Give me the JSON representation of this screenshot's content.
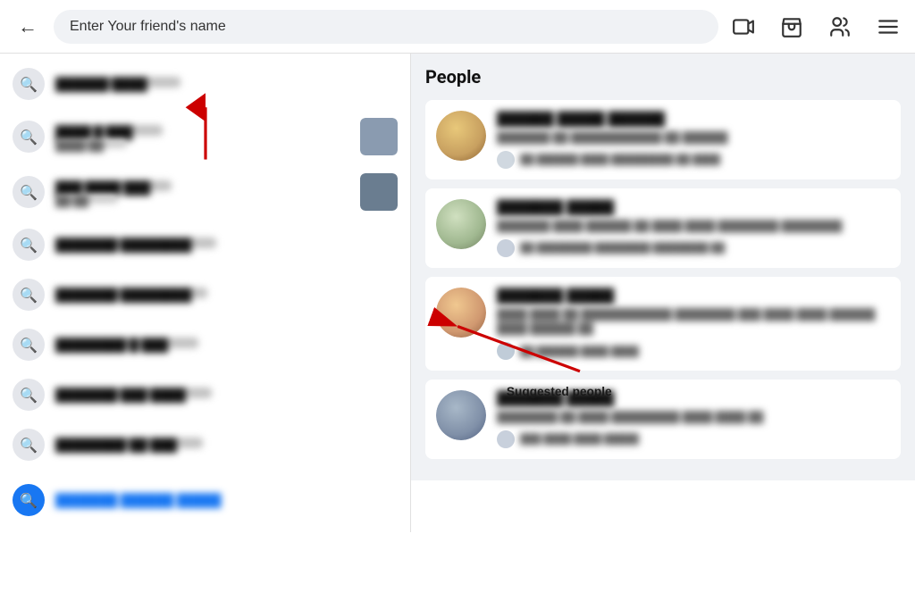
{
  "header": {
    "back_label": "←",
    "search_placeholder": "Enter Your friend's name",
    "nav_icons": [
      "video-icon",
      "shop-icon",
      "people-icon",
      "menu-icon"
    ]
  },
  "left_panel": {
    "results": [
      {
        "id": 1,
        "main": "██████ ████",
        "sub": "",
        "has_avatar": false,
        "avatar_color": ""
      },
      {
        "id": 2,
        "main": "████ █ ███",
        "sub": "████ ██",
        "has_avatar": true,
        "avatar_color": "#8a9bb0"
      },
      {
        "id": 3,
        "main": "███ ████ ███",
        "sub": "██ ██",
        "has_avatar": true,
        "avatar_color": "#6a7d90"
      },
      {
        "id": 4,
        "main": "███████ ████████",
        "sub": "",
        "has_avatar": false,
        "avatar_color": ""
      },
      {
        "id": 5,
        "main": "███████ ████████",
        "sub": "",
        "has_avatar": false,
        "avatar_color": ""
      },
      {
        "id": 6,
        "main": "████████ █ ███",
        "sub": "",
        "has_avatar": false,
        "avatar_color": ""
      },
      {
        "id": 7,
        "main": "███████ ███ ████",
        "sub": "",
        "has_avatar": false,
        "avatar_color": ""
      },
      {
        "id": 8,
        "main": "████████ ██ ███",
        "sub": "",
        "has_avatar": false,
        "avatar_color": ""
      }
    ],
    "bottom_search": "███████ ██████ █████"
  },
  "right_panel": {
    "section_title": "People",
    "people": [
      {
        "id": 1,
        "name": "██████ █████ ██████",
        "desc": "███████ ██ ████████████ ██ ██████",
        "mutual": "██ ██████ ████ █████████ ██ ████",
        "avatar_color": "#c8a060"
      },
      {
        "id": 2,
        "name": "███████ █████",
        "desc": "███████ ████ ██████ ██ ████ ████ ████████ ████████",
        "mutual": "██ ████████ ████████ ████████ ██",
        "avatar_color": "#a0b890"
      },
      {
        "id": 3,
        "name": "███████ █████",
        "desc": "████ ████ ██ ████████████ ████████ ███ ████ ████ ██████ ████ ██████ ██",
        "mutual": "██ ██████ ████ ████",
        "avatar_color": "#d09870"
      },
      {
        "id": 4,
        "name": "███████ █████",
        "desc": "████████ ██ ████ █████████ ████ ████ ██",
        "mutual": "███ ████ ████ █████",
        "avatar_color": "#8090a8"
      }
    ]
  },
  "annotations": {
    "suggested_label": "Suggested people"
  }
}
